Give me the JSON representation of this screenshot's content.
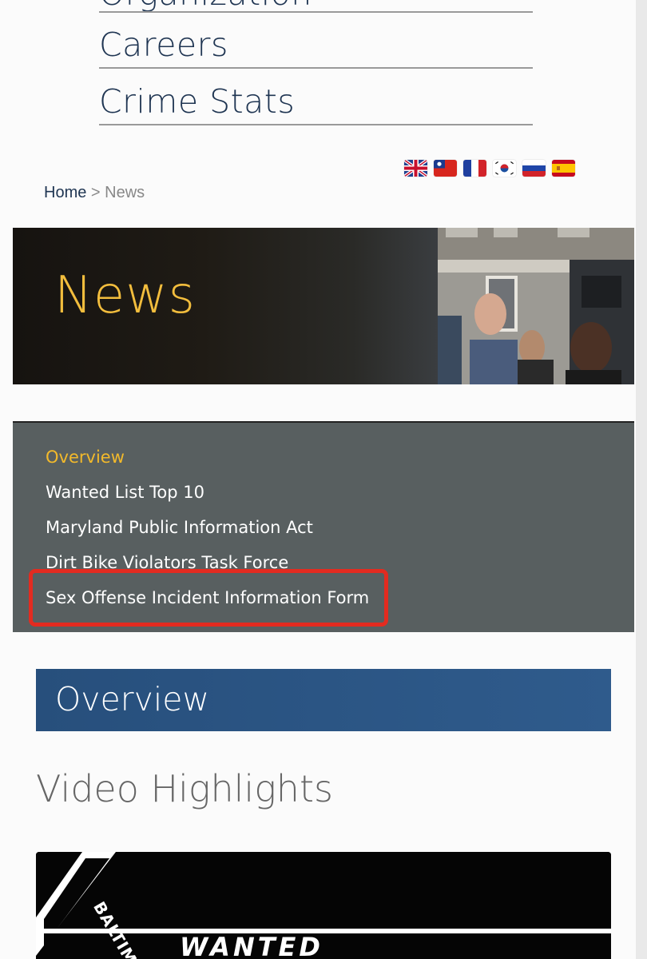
{
  "nav": {
    "items": [
      {
        "label": "Organization"
      },
      {
        "label": "Careers"
      },
      {
        "label": "Crime Stats"
      }
    ]
  },
  "languages": [
    {
      "name": "English",
      "icon": "uk-flag-icon"
    },
    {
      "name": "Chinese",
      "icon": "taiwan-flag-icon"
    },
    {
      "name": "French",
      "icon": "france-flag-icon"
    },
    {
      "name": "Korean",
      "icon": "korea-flag-icon"
    },
    {
      "name": "Russian",
      "icon": "russia-flag-icon"
    },
    {
      "name": "Spanish",
      "icon": "spain-flag-icon"
    }
  ],
  "breadcrumb": {
    "home": "Home",
    "separator": ">",
    "current": "News"
  },
  "hero": {
    "title": "News"
  },
  "sidemenu": {
    "items": [
      {
        "label": "Overview",
        "active": true
      },
      {
        "label": "Wanted List Top 10",
        "active": false
      },
      {
        "label": "Maryland Public Information Act",
        "active": false
      },
      {
        "label": "Dirt Bike Violators Task Force",
        "active": false
      },
      {
        "label": "Sex Offense Incident Information Form",
        "active": false
      }
    ],
    "highlighted_item": "Sex Offense Incident Information Form"
  },
  "overview": {
    "title": "Overview"
  },
  "video": {
    "heading": "Video Highlights",
    "thumbnail": {
      "text_wanted": "WANTED",
      "text_baltimore": "BALTIMORE"
    }
  },
  "colors": {
    "nav_text": "#1f3552",
    "hero_title": "#f2bd3d",
    "menu_bg": "#585f60",
    "menu_active": "#f2b92b",
    "highlight": "#e32b20",
    "overview_bg": "#2b5585"
  }
}
